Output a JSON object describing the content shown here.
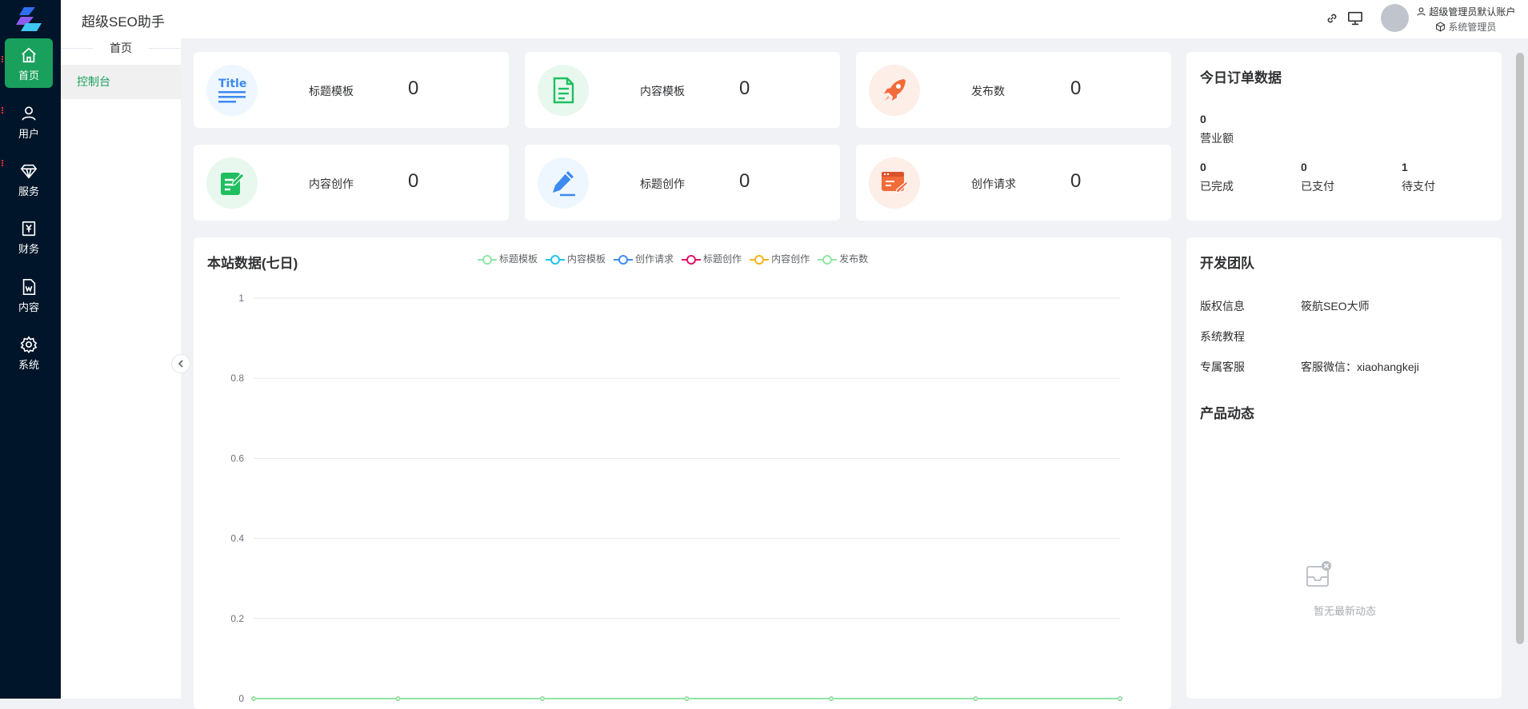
{
  "app_title": "超级SEO助手",
  "user": {
    "name": "超级管理员默认账户",
    "role": "系统管理员"
  },
  "rail": [
    {
      "id": "home",
      "label": "首页",
      "icon": "home-icon"
    },
    {
      "id": "user",
      "label": "用户",
      "icon": "user-icon"
    },
    {
      "id": "service",
      "label": "服务",
      "icon": "diamond-icon"
    },
    {
      "id": "finance",
      "label": "财务",
      "icon": "finance-icon"
    },
    {
      "id": "content",
      "label": "内容",
      "icon": "document-icon"
    },
    {
      "id": "system",
      "label": "系统",
      "icon": "gear-icon"
    }
  ],
  "subnav": {
    "title": "首页",
    "items": [
      {
        "label": "控制台"
      }
    ]
  },
  "stats": [
    {
      "label": "标题模板",
      "value": "0",
      "icon": "title-icon",
      "bg": "#eef7ff"
    },
    {
      "label": "内容模板",
      "value": "0",
      "icon": "document-icon",
      "bg": "#e8f8ee"
    },
    {
      "label": "发布数",
      "value": "0",
      "icon": "rocket-icon",
      "bg": "#fdeee8"
    },
    {
      "label": "内容创作",
      "value": "0",
      "icon": "edit-note-icon",
      "bg": "#e8f8ee"
    },
    {
      "label": "标题创作",
      "value": "0",
      "icon": "pen-icon",
      "bg": "#eef7ff"
    },
    {
      "label": "创作请求",
      "value": "0",
      "icon": "request-icon",
      "bg": "#fdeee8"
    }
  ],
  "orders": {
    "title": "今日订单数据",
    "revenue": {
      "value": "0",
      "label": "营业额"
    },
    "completed": {
      "value": "0",
      "label": "已完成"
    },
    "paid": {
      "value": "0",
      "label": "已支付"
    },
    "pending": {
      "value": "1",
      "label": "待支付"
    }
  },
  "team": {
    "title": "开发团队",
    "rows": [
      {
        "key": "版权信息",
        "value": "筱航SEO大师"
      },
      {
        "key": "系统教程",
        "value": ""
      },
      {
        "key": "专属客服",
        "value": "客服微信：xiaohangkeji"
      }
    ]
  },
  "news": {
    "title": "产品动态",
    "empty": "暂无最新动态"
  },
  "colors": {
    "accent": "#19a05c",
    "rail_bg": "#001529"
  },
  "chart_data": {
    "type": "line",
    "title": "本站数据(七日)",
    "ylim": [
      0,
      1
    ],
    "yticks": [
      "1",
      "0.8",
      "0.6",
      "0.4",
      "0.2",
      "0"
    ],
    "grid": true,
    "legend_position": "top",
    "x_count": 7,
    "series": [
      {
        "name": "标题模板",
        "color": "#91e6a6",
        "values": [
          0,
          0,
          0,
          0,
          0,
          0,
          0
        ]
      },
      {
        "name": "内容模板",
        "color": "#20c4e8",
        "values": [
          0,
          0,
          0,
          0,
          0,
          0,
          0
        ]
      },
      {
        "name": "创作请求",
        "color": "#3f8cf2",
        "values": [
          0,
          0,
          0,
          0,
          0,
          0,
          0
        ]
      },
      {
        "name": "标题创作",
        "color": "#e8126a",
        "values": [
          0,
          0,
          0,
          0,
          0,
          0,
          0
        ]
      },
      {
        "name": "内容创作",
        "color": "#f5b41a",
        "values": [
          0,
          0,
          0,
          0,
          0,
          0,
          0
        ]
      },
      {
        "name": "发布数",
        "color": "#91e6a6",
        "values": [
          0,
          0,
          0,
          0,
          0,
          0,
          0
        ]
      }
    ]
  }
}
